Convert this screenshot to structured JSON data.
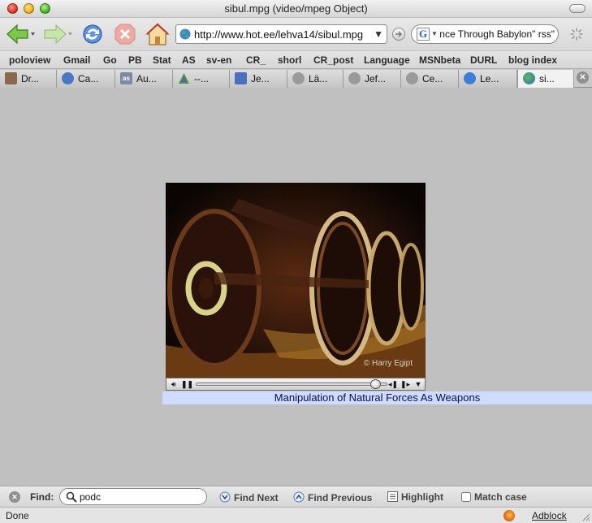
{
  "window": {
    "title": "sibul.mpg (video/mpeg Object)"
  },
  "toolbar": {
    "url": "http://www.hot.ee/lehva14/sibul.mpg",
    "search_value": "\"Dance Through Babylon\" rss"
  },
  "bookmarks": [
    "poloview",
    "Gmail",
    "Go",
    "PB",
    "Stat",
    "AS",
    "sv-en",
    "CR_",
    "shorl",
    "CR_post",
    "Language",
    "MSNbeta",
    "DURL",
    "blog index"
  ],
  "tabs": [
    {
      "label": "Dr...",
      "icon": "page-icon",
      "color": "#8a6a4a"
    },
    {
      "label": "Ca...",
      "icon": "swirl-icon",
      "color": "#4a76c8"
    },
    {
      "label": "Au...",
      "icon": "as-icon",
      "color": "#7b8ba3"
    },
    {
      "label": "--...",
      "icon": "triangle-icon",
      "color": "#3aa23a"
    },
    {
      "label": "Je...",
      "icon": "chart-icon",
      "color": "#4a70c0"
    },
    {
      "label": "Lä...",
      "icon": "globe-grey-icon",
      "color": "#9a9a9a"
    },
    {
      "label": "Jef...",
      "icon": "globe-grey-icon",
      "color": "#9a9a9a"
    },
    {
      "label": "Ce...",
      "icon": "globe-grey-icon",
      "color": "#9a9a9a"
    },
    {
      "label": "Le...",
      "icon": "globe-blue-icon",
      "color": "#3d7fd6"
    },
    {
      "label": "si...",
      "icon": "globe-green-icon",
      "color": "#2f8f4a",
      "active": true
    }
  ],
  "video": {
    "watermark": "© Harry Egipt",
    "progress": 0.94,
    "caption": "Manipulation of Natural Forces As Weapons"
  },
  "find": {
    "label": "Find:",
    "value": "podc",
    "next": "Find Next",
    "previous": "Find Previous",
    "highlight": "Highlight",
    "match_case": "Match case"
  },
  "status": {
    "text": "Done",
    "adblock": "Adblock"
  }
}
